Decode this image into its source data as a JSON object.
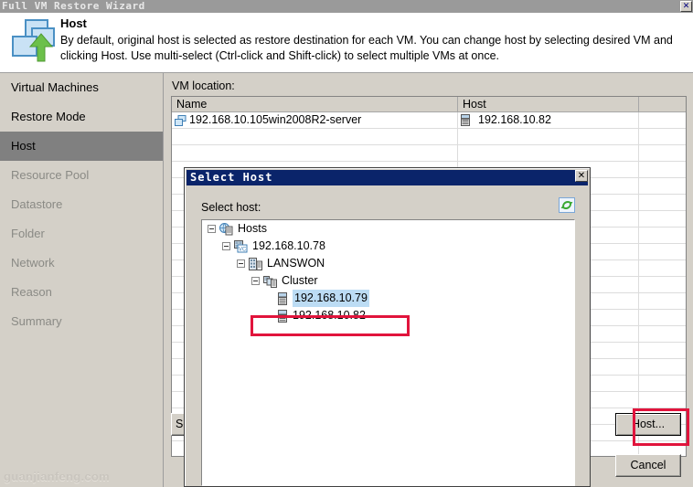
{
  "window": {
    "title": "Full VM Restore Wizard",
    "close_label": "✕"
  },
  "header": {
    "title": "Host",
    "description": "By default, original host is selected as restore destination for each VM. You can change host by selecting desired VM and clicking Host. Use multi-select (Ctrl-click and Shift-click) to select multiple VMs at once.",
    "icon": "vm-restore-icon"
  },
  "sidebar": {
    "items": [
      {
        "label": "Virtual Machines",
        "state": "done"
      },
      {
        "label": "Restore Mode",
        "state": "done"
      },
      {
        "label": "Host",
        "state": "selected"
      },
      {
        "label": "Resource Pool",
        "state": "disabled"
      },
      {
        "label": "Datastore",
        "state": "disabled"
      },
      {
        "label": "Folder",
        "state": "disabled"
      },
      {
        "label": "Network",
        "state": "disabled"
      },
      {
        "label": "Reason",
        "state": "disabled"
      },
      {
        "label": "Summary",
        "state": "disabled"
      }
    ],
    "watermark": "guanjianfeng.com"
  },
  "main": {
    "vm_location_label": "VM location:",
    "grid": {
      "columns": [
        "Name",
        "Host",
        ""
      ],
      "rows": [
        {
          "name": "192.168.10.105win2008R2-server",
          "host": "192.168.10.82",
          "extra": ""
        }
      ],
      "empty_row_count": 20
    },
    "buttons": {
      "select_partial": "Se",
      "host": "Host...",
      "cancel": "Cancel"
    }
  },
  "dialog": {
    "title": "Select Host",
    "close_label": "✕",
    "select_host_label": "Select host:",
    "refresh_icon": "refresh-icon",
    "tree": [
      {
        "label": "Hosts",
        "depth": 0,
        "icon": "hosts-root-icon",
        "expanded": true,
        "selected": false
      },
      {
        "label": "192.168.10.78",
        "depth": 1,
        "icon": "vcenter-icon",
        "expanded": true,
        "selected": false
      },
      {
        "label": "LANSWON",
        "depth": 2,
        "icon": "datacenter-icon",
        "expanded": true,
        "selected": false
      },
      {
        "label": "Cluster",
        "depth": 3,
        "icon": "cluster-icon",
        "expanded": true,
        "selected": false
      },
      {
        "label": "192.168.10.79",
        "depth": 4,
        "icon": "esx-host-icon",
        "expanded": false,
        "selected": true
      },
      {
        "label": "192.168.10.82",
        "depth": 4,
        "icon": "esx-host-icon",
        "expanded": false,
        "selected": false
      }
    ]
  },
  "annotations": {
    "highlight_color": "#e1143c",
    "boxes": [
      "selected-host-tree-node",
      "host-button"
    ]
  }
}
